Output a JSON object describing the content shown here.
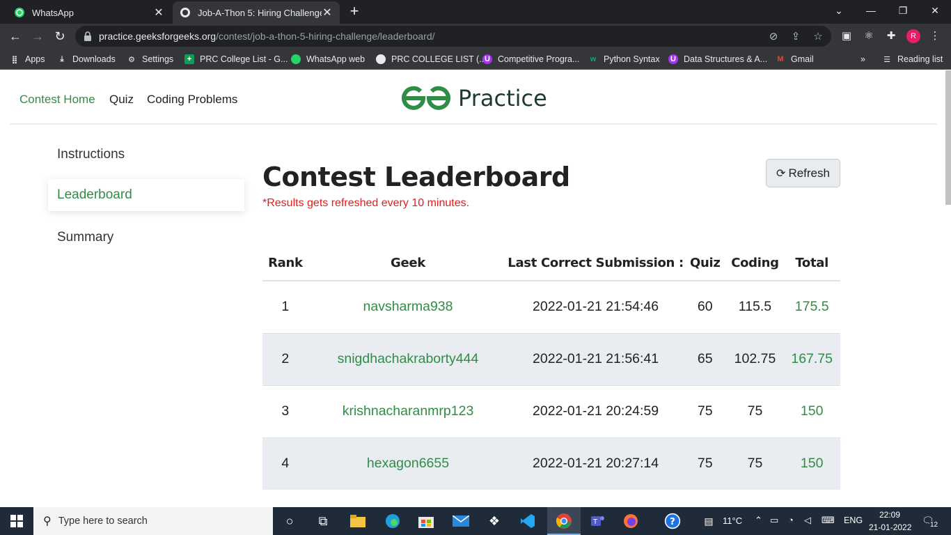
{
  "browser": {
    "tabs": [
      {
        "title": "WhatsApp",
        "active": false
      },
      {
        "title": "Job-A-Thon 5: Hiring Challenge |",
        "active": true
      }
    ],
    "url_host": "practice.geeksforgeeks.org",
    "url_path": "/contest/job-a-thon-5-hiring-challenge/leaderboard/",
    "profile_initial": "R",
    "bookmarks": [
      {
        "label": "Apps",
        "icon": "apps-grid-icon"
      },
      {
        "label": "Downloads",
        "icon": "download-icon"
      },
      {
        "label": "Settings",
        "icon": "gear-icon"
      },
      {
        "label": "PRC College List - G...",
        "icon": "sheets-icon"
      },
      {
        "label": "WhatsApp web",
        "icon": "whatsapp-icon"
      },
      {
        "label": "PRC COLLEGE LIST (...",
        "icon": "globe-icon"
      },
      {
        "label": "Competitive Progra...",
        "icon": "udemy-icon"
      },
      {
        "label": "Python Syntax",
        "icon": "w3-icon"
      },
      {
        "label": "Data Structures & A...",
        "icon": "udemy-icon"
      },
      {
        "label": "Gmail",
        "icon": "gmail-icon"
      }
    ],
    "reading_list": "Reading list",
    "more_bookmarks": "»"
  },
  "site": {
    "nav": [
      {
        "label": "Contest Home",
        "active": true
      },
      {
        "label": "Quiz",
        "active": false
      },
      {
        "label": "Coding Problems",
        "active": false
      }
    ],
    "logo_text": "Practice",
    "brand_color": "#2f8d46"
  },
  "sidebar": {
    "items": [
      {
        "label": "Instructions",
        "active": false
      },
      {
        "label": "Leaderboard",
        "active": true
      },
      {
        "label": "Summary",
        "active": false
      }
    ]
  },
  "main": {
    "title": "Contest Leaderboard",
    "note": "*Results gets refreshed every 10 minutes.",
    "refresh_label": "Refresh"
  },
  "leaderboard": {
    "columns": [
      "Rank",
      "Geek",
      "Last Correct Submission :",
      "Quiz",
      "Coding",
      "Total"
    ],
    "rows": [
      {
        "rank": "1",
        "geek": "navsharma938",
        "last": "2022-01-21 21:54:46",
        "quiz": "60",
        "coding": "115.5",
        "total": "175.5"
      },
      {
        "rank": "2",
        "geek": "snigdhachakraborty444",
        "last": "2022-01-21 21:56:41",
        "quiz": "65",
        "coding": "102.75",
        "total": "167.75"
      },
      {
        "rank": "3",
        "geek": "krishnacharanmrp123",
        "last": "2022-01-21 20:24:59",
        "quiz": "75",
        "coding": "75",
        "total": "150"
      },
      {
        "rank": "4",
        "geek": "hexagon6655",
        "last": "2022-01-21 20:27:14",
        "quiz": "75",
        "coding": "75",
        "total": "150"
      }
    ]
  },
  "taskbar": {
    "search_placeholder": "Type here to search",
    "weather": "11°C",
    "language": "ENG",
    "time": "22:09",
    "date": "21-01-2022",
    "notification_count": "12"
  }
}
